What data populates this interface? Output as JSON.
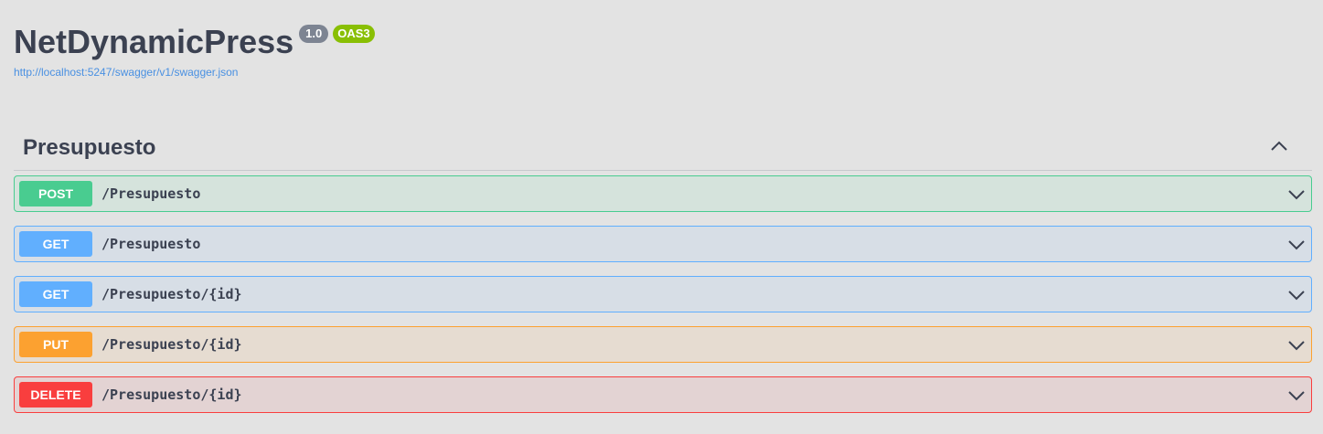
{
  "info": {
    "title": "NetDynamicPress",
    "version": "1.0",
    "oas_badge": "OAS3",
    "spec_url": "http://localhost:5247/swagger/v1/swagger.json"
  },
  "tag": {
    "name": "Presupuesto",
    "toggle_icon": "chevron-up-icon"
  },
  "operations": [
    {
      "method": "POST",
      "path": "/Presupuesto",
      "color": "#49cc90"
    },
    {
      "method": "GET",
      "path": "/Presupuesto",
      "color": "#61affe"
    },
    {
      "method": "GET",
      "path": "/Presupuesto/{id}",
      "color": "#61affe"
    },
    {
      "method": "PUT",
      "path": "/Presupuesto/{id}",
      "color": "#fca130"
    },
    {
      "method": "DELETE",
      "path": "/Presupuesto/{id}",
      "color": "#f93e3e"
    }
  ],
  "colors": {
    "background": "#e3e3e3",
    "text": "#3b4151",
    "link": "#4990e2",
    "version_badge": "#7d8492",
    "oas_badge": "#89bf04"
  }
}
